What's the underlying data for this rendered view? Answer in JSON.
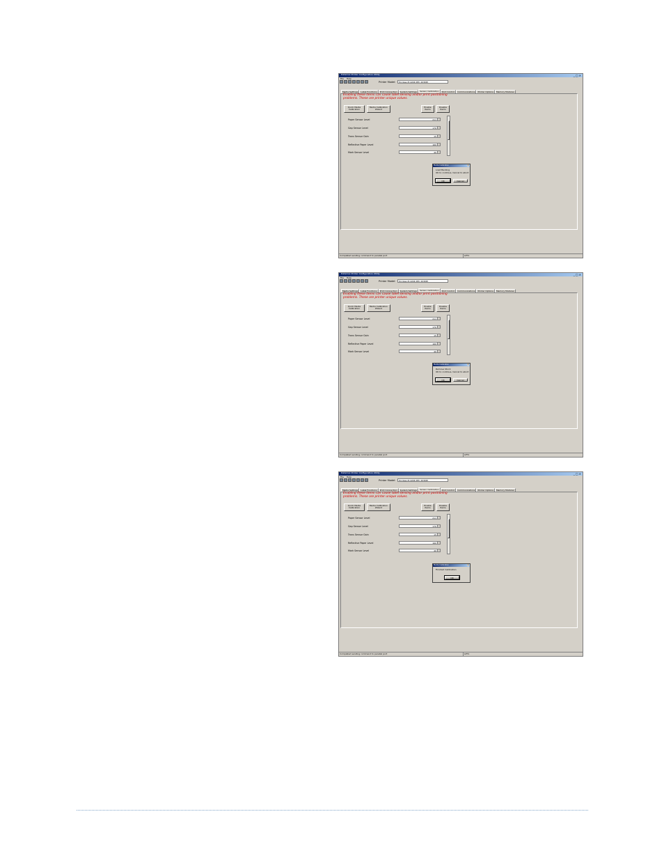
{
  "screenshots": [
    {
      "window_title": "Datamax Printer Configuration Utility",
      "menu": [
        "File",
        "Help"
      ],
      "printer_model_label": "Printer Model:",
      "printer_model_value": "M-Class M-4206 RTC 203DPI",
      "tabs": [
        "Media Settings",
        "Label Functions",
        "Print Connection",
        "System Settings",
        "Sensor Calibration",
        "Print Control",
        "Communications",
        "Printer Options",
        "Memory Modules"
      ],
      "active_tab": "Sensor Calibration",
      "warning_line1": "Enabling these items can cause label sensing and/or print positioning",
      "warning_line2": "problems. These are printer unique values.",
      "quick_button": "Quick Media\nCalibration",
      "wizard_button": "Media Calibration\nWizard",
      "enable_button": "Enable\nItems",
      "disable_button": "Disable\nItems",
      "fields": [
        {
          "label": "Paper Sensor Level",
          "value": "211"
        },
        {
          "label": "Gap Sensor Level",
          "value": "170"
        },
        {
          "label": "Trans Sensor Gain",
          "value": "15"
        },
        {
          "label": "Reflective Paper Level",
          "value": "160"
        },
        {
          "label": "Mark Sensor Level",
          "value": "40"
        }
      ],
      "dialog": {
        "title": "Media Calibration",
        "message": "Load Backing\nOK to continue, Cancel to abort",
        "ok": "OK",
        "cancel": "Cancel"
      },
      "status_left": "Completed sending command to parallel port",
      "status_right": "LPT1"
    },
    {
      "window_title": "Datamax Printer Configuration Utility",
      "menu": [
        "File",
        "Help"
      ],
      "printer_model_label": "Printer Model:",
      "printer_model_value": "M-Class M-4206 RTC 203DPI",
      "tabs": [
        "Media Settings",
        "Label Functions",
        "Print Connection",
        "System Settings",
        "Sensor Calibration",
        "Print Control",
        "Communications",
        "Printer Options",
        "Memory Modules"
      ],
      "active_tab": "Sensor Calibration",
      "warning_line1": "Enabling these items can cause label sensing and/or print positioning",
      "warning_line2": "problems. These are printer unique values.",
      "quick_button": "Quick Media\nCalibration",
      "wizard_button": "Media Calibration\nWizard",
      "enable_button": "Enable\nItems",
      "disable_button": "Disable\nItems",
      "fields": [
        {
          "label": "Paper Sensor Level",
          "value": "211"
        },
        {
          "label": "Gap Sensor Level",
          "value": "170"
        },
        {
          "label": "Trans Sensor Gain",
          "value": "15"
        },
        {
          "label": "Reflective Paper Level",
          "value": "160"
        },
        {
          "label": "Mark Sensor Level",
          "value": "40"
        }
      ],
      "dialog": {
        "title": "Media Calibration",
        "message": "Remove Stock\nOK to continue, Cancel to abort",
        "ok": "OK",
        "cancel": "Cancel"
      },
      "status_left": "Completed sending command to parallel port",
      "status_right": "LPT1"
    },
    {
      "window_title": "Datamax Printer Configuration Utility",
      "menu": [
        "File",
        "Help"
      ],
      "printer_model_label": "Printer Model:",
      "printer_model_value": "M-Class M-4206 RTC 203DPI",
      "tabs": [
        "Media Settings",
        "Label Functions",
        "Print Connection",
        "System Settings",
        "Sensor Calibration",
        "Print Control",
        "Communications",
        "Printer Options",
        "Memory Modules"
      ],
      "active_tab": "Sensor Calibration",
      "warning_line1": "Enabling these items can cause label sensing and/or print positioning",
      "warning_line2": "problems. These are printer unique values.",
      "quick_button": "Quick Media\nCalibration",
      "wizard_button": "Media Calibration\nWizard",
      "enable_button": "Enable\nItems",
      "disable_button": "Disable\nItems",
      "fields": [
        {
          "label": "Paper Sensor Level",
          "value": "211"
        },
        {
          "label": "Gap Sensor Level",
          "value": "170"
        },
        {
          "label": "Trans Sensor Gain",
          "value": "15"
        },
        {
          "label": "Reflective Paper Level",
          "value": "160"
        },
        {
          "label": "Mark Sensor Level",
          "value": "40"
        }
      ],
      "dialog": {
        "title": "Media Calibration",
        "message": "Finished Calibration",
        "ok": "OK"
      },
      "status_left": "Completed sending command to parallel port",
      "status_right": "LPT1"
    }
  ]
}
